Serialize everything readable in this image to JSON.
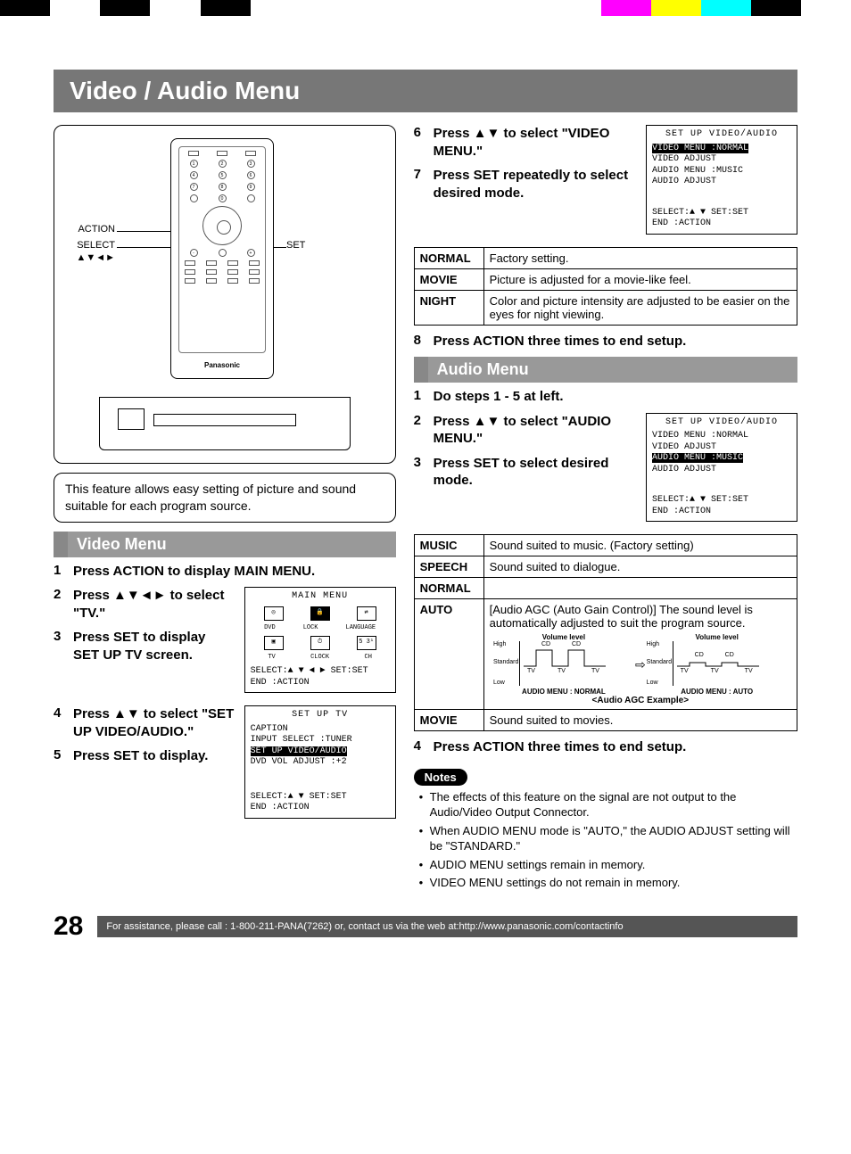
{
  "colorbar": [
    "#000",
    "#fff",
    "#000",
    "#fff",
    "#000",
    "#fff",
    "#fff",
    "#fff",
    "#fff",
    "#fff",
    "#fff",
    "#fff",
    "#f0f",
    "#ff0",
    "#0ff",
    "#000",
    "#fff"
  ],
  "title": "Video / Audio Menu",
  "remote_labels": {
    "action": "ACTION",
    "select": "SELECT",
    "arrows": "▲▼◄►",
    "set": "SET",
    "brand": "Panasonic"
  },
  "intro": "This feature allows easy setting of picture and sound suitable for each program source.",
  "video_menu_header": "Video Menu",
  "video_steps": {
    "s1": {
      "n": "1",
      "t": "Press ACTION to display MAIN MENU."
    },
    "s2": {
      "n": "2",
      "t_a": "Press ",
      "t_b": "▲▼◄►",
      "t_c": " to select \"TV.\""
    },
    "s3": {
      "n": "3",
      "t": "Press SET to display SET UP TV screen."
    },
    "s4": {
      "n": "4",
      "t_a": "Press ",
      "t_b": "▲▼",
      "t_c": " to select \"SET UP VIDEO/AUDIO.\""
    },
    "s5": {
      "n": "5",
      "t": "Press SET to display."
    },
    "s6": {
      "n": "6",
      "t_a": "Press ",
      "t_b": "▲▼",
      "t_c": " to select \"VIDEO MENU.\""
    },
    "s7": {
      "n": "7",
      "t": "Press SET repeatedly to select desired mode."
    },
    "s8": {
      "n": "8",
      "t": "Press ACTION three times to end setup."
    }
  },
  "osd_main": {
    "title": "MAIN  MENU",
    "row1": [
      "DVD",
      "LOCK",
      "LANGUAGE"
    ],
    "row2": [
      "TV",
      "CLOCK",
      "CH"
    ],
    "sel": "SELECT:▲ ▼ ◄ ►   SET:SET",
    "end": "END   :ACTION"
  },
  "osd_tv": {
    "title": "SET  UP  TV",
    "l1": "CAPTION",
    "l2": "INPUT SELECT    :TUNER",
    "l3": "SET UP VIDEO/AUDIO",
    "l4": "DVD VOL ADJUST :+2",
    "sel": "SELECT:▲ ▼        SET:SET",
    "end": "END   :ACTION"
  },
  "osd_video": {
    "title": "SET  UP  VIDEO/AUDIO",
    "l1": "VIDEO MENU    :NORMAL",
    "l2": "VIDEO ADJUST",
    "l3": "AUDIO MENU    :MUSIC",
    "l4": "AUDIO ADJUST",
    "sel": "SELECT:▲ ▼       SET:SET",
    "end": "END   :ACTION"
  },
  "video_modes": [
    {
      "k": "NORMAL",
      "v": "Factory setting."
    },
    {
      "k": "MOVIE",
      "v": "Picture is adjusted for a movie-like feel."
    },
    {
      "k": "NIGHT",
      "v": "Color and picture intensity are adjusted to be easier on the eyes for night viewing."
    }
  ],
  "audio_menu_header": "Audio Menu",
  "audio_steps": {
    "s1": {
      "n": "1",
      "t": "Do steps 1 - 5 at left."
    },
    "s2": {
      "n": "2",
      "t_a": "Press ",
      "t_b": "▲▼",
      "t_c": " to select \"AUDIO MENU.\""
    },
    "s3": {
      "n": "3",
      "t": "Press SET to select desired mode."
    },
    "s4": {
      "n": "4",
      "t": "Press ACTION three times to end setup."
    }
  },
  "osd_audio": {
    "title": "SET  UP  VIDEO/AUDIO",
    "l1": "VIDEO MENU    :NORMAL",
    "l2": "VIDEO ADJUST",
    "l3": "AUDIO MENU    :MUSIC",
    "l4": "AUDIO ADJUST",
    "sel": "SELECT:▲ ▼       SET:SET",
    "end": "END   :ACTION"
  },
  "audio_modes": {
    "music": {
      "k": "MUSIC",
      "v": "Sound suited to music. (Factory setting)"
    },
    "speech": {
      "k": "SPEECH",
      "v": "Sound suited to dialogue."
    },
    "normal": {
      "k": "NORMAL",
      "v": ""
    },
    "auto": {
      "k": "AUTO",
      "v": "[Audio AGC (Auto Gain Control)] The sound level is automatically adjusted to suit the program source."
    },
    "movie": {
      "k": "MOVIE",
      "v": "Sound suited to movies."
    }
  },
  "agc": {
    "left_title": "Volume level",
    "right_title": "Volume level",
    "y_high": "High",
    "y_std": "Standard",
    "y_low": "Low",
    "seg_cd": "CD",
    "seg_tv": "TV",
    "left_cap": "AUDIO MENU : NORMAL",
    "right_cap": "AUDIO MENU : AUTO",
    "example": "<Audio AGC Example>"
  },
  "notes_header": "Notes",
  "notes": [
    "The effects of this feature on the signal are not output to the Audio/Video Output Connector.",
    "When AUDIO MENU mode is \"AUTO,\" the AUDIO ADJUST setting will be \"STANDARD.\"",
    "AUDIO MENU settings remain in memory.",
    "VIDEO MENU settings do not remain in memory."
  ],
  "page_number": "28",
  "footer": "For assistance, please call : 1-800-211-PANA(7262) or, contact us via the web at:http://www.panasonic.com/contactinfo",
  "chart_data": {
    "type": "line",
    "title": "<Audio AGC Example>",
    "series": [
      {
        "name": "AUDIO MENU : NORMAL",
        "segments": [
          "TV",
          "CD",
          "TV",
          "CD",
          "TV"
        ],
        "levels": [
          "Standard",
          "High",
          "Standard",
          "High",
          "Standard"
        ]
      },
      {
        "name": "AUDIO MENU : AUTO",
        "segments": [
          "TV",
          "CD",
          "TV",
          "CD",
          "TV"
        ],
        "levels": [
          "Standard",
          "Standard",
          "Standard",
          "Standard",
          "Standard"
        ]
      }
    ],
    "y_levels": [
      "Low",
      "Standard",
      "High"
    ],
    "ylabel": "Volume level"
  }
}
